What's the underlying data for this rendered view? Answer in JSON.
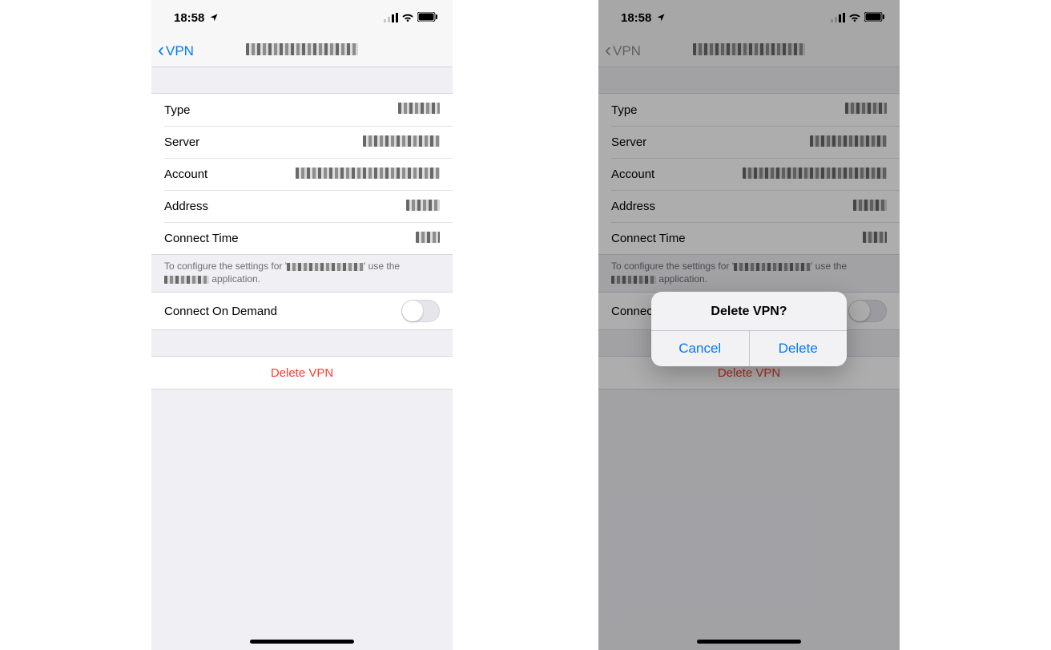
{
  "status": {
    "time": "18:58"
  },
  "nav": {
    "back_label": "VPN"
  },
  "rows": {
    "type": "Type",
    "server": "Server",
    "account": "Account",
    "address": "Address",
    "connect_time": "Connect Time"
  },
  "footer": {
    "prefix": "To configure the settings for '",
    "suffix": "' use the ",
    "tail": " application."
  },
  "connect_on_demand": "Connect On Demand",
  "delete_vpn": "Delete VPN",
  "alert": {
    "title": "Delete VPN?",
    "cancel": "Cancel",
    "delete": "Delete"
  },
  "colors": {
    "ios_blue": "#007aff",
    "ios_red": "#ff3b30",
    "ios_bg": "#efeff4",
    "ios_group": "#ffffff",
    "ios_grey": "#8e8e93"
  }
}
